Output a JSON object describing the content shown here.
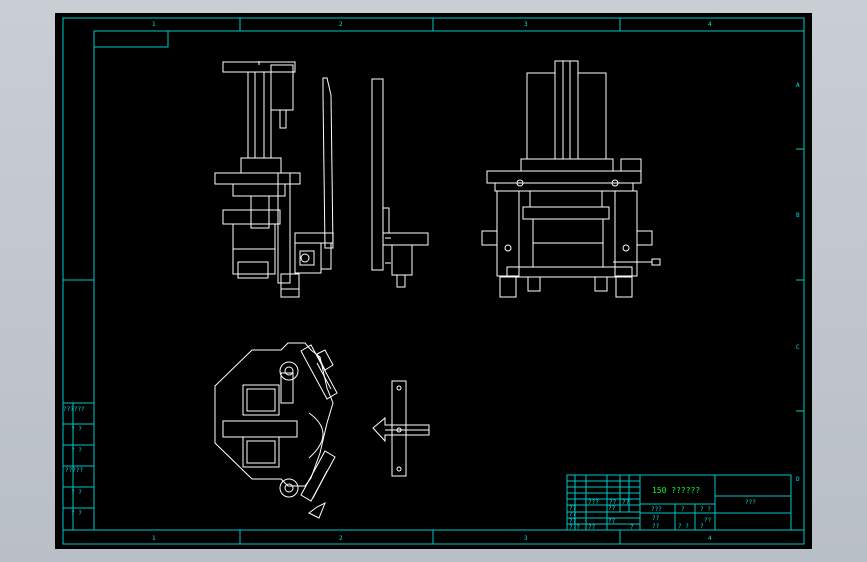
{
  "drawing": {
    "zone_columns": [
      "1",
      "2",
      "3",
      "4"
    ],
    "zone_rows": [
      "A",
      "B",
      "C",
      "D"
    ]
  },
  "left_strip": {
    "labels": [
      "??????",
      "? ?",
      "? ?",
      "?????",
      "? ?",
      "? ?"
    ]
  },
  "title_block": {
    "title": "150 ??????",
    "right_label": "???",
    "small_cells": [
      "??",
      "???",
      "??",
      "??",
      "??",
      "??",
      "??",
      "??",
      "???",
      "?",
      "? ?",
      "??",
      "??",
      "??",
      "? ?",
      "?",
      "? ?",
      "??",
      "?"
    ]
  },
  "colors": {
    "background": "#000000",
    "frame": "#00c8c8",
    "geometry": "#ffffff",
    "title_text": "#00ff3c"
  }
}
